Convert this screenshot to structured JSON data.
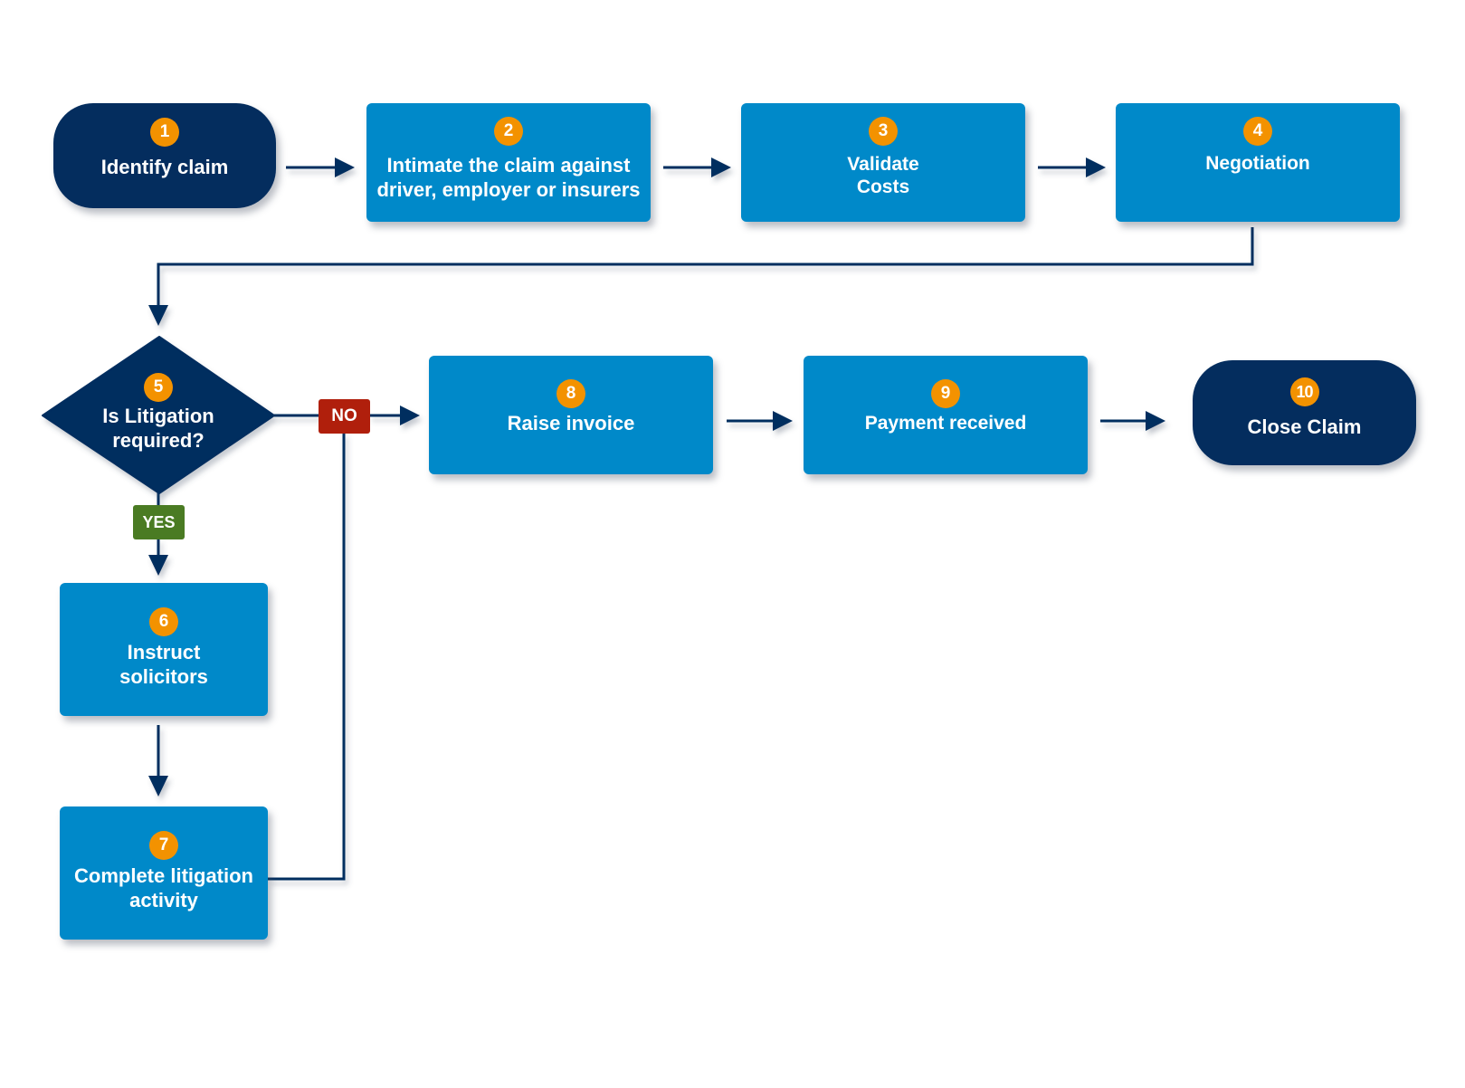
{
  "diagram": {
    "type": "flowchart",
    "colors": {
      "process": "#0089C9",
      "terminal": "#042D5E",
      "step_number": "#F39200",
      "connector": "#042D5E",
      "no_tag": "#B01F0C",
      "yes_tag": "#4A7B23"
    },
    "nodes": [
      {
        "id": "1",
        "number": "1",
        "shape": "terminal",
        "label": "Identify claim"
      },
      {
        "id": "2",
        "number": "2",
        "shape": "process",
        "label": "Intimate the claim against\ndriver, employer or insurers"
      },
      {
        "id": "3",
        "number": "3",
        "shape": "process",
        "label": "Validate\nCosts"
      },
      {
        "id": "4",
        "number": "4",
        "shape": "process",
        "label": "Negotiation"
      },
      {
        "id": "5",
        "number": "5",
        "shape": "decision",
        "label": "Is Litigation\nrequired?"
      },
      {
        "id": "6",
        "number": "6",
        "shape": "process",
        "label": "Instruct\nsolicitors"
      },
      {
        "id": "7",
        "number": "7",
        "shape": "process",
        "label": "Complete litigation\nactivity"
      },
      {
        "id": "8",
        "number": "8",
        "shape": "process",
        "label": "Raise invoice"
      },
      {
        "id": "9",
        "number": "9",
        "shape": "process",
        "label": "Payment received"
      },
      {
        "id": "10",
        "number": "10",
        "shape": "terminal",
        "label": "Close Claim"
      }
    ],
    "edges": [
      {
        "from": "1",
        "to": "2",
        "label": ""
      },
      {
        "from": "2",
        "to": "3",
        "label": ""
      },
      {
        "from": "3",
        "to": "4",
        "label": ""
      },
      {
        "from": "4",
        "to": "5",
        "label": ""
      },
      {
        "from": "5",
        "to": "8",
        "label": "NO"
      },
      {
        "from": "5",
        "to": "6",
        "label": "YES"
      },
      {
        "from": "6",
        "to": "7",
        "label": ""
      },
      {
        "from": "7",
        "to": "8",
        "label": ""
      },
      {
        "from": "8",
        "to": "9",
        "label": ""
      },
      {
        "from": "9",
        "to": "10",
        "label": ""
      }
    ],
    "decision_labels": {
      "no": "NO",
      "yes": "YES"
    }
  }
}
